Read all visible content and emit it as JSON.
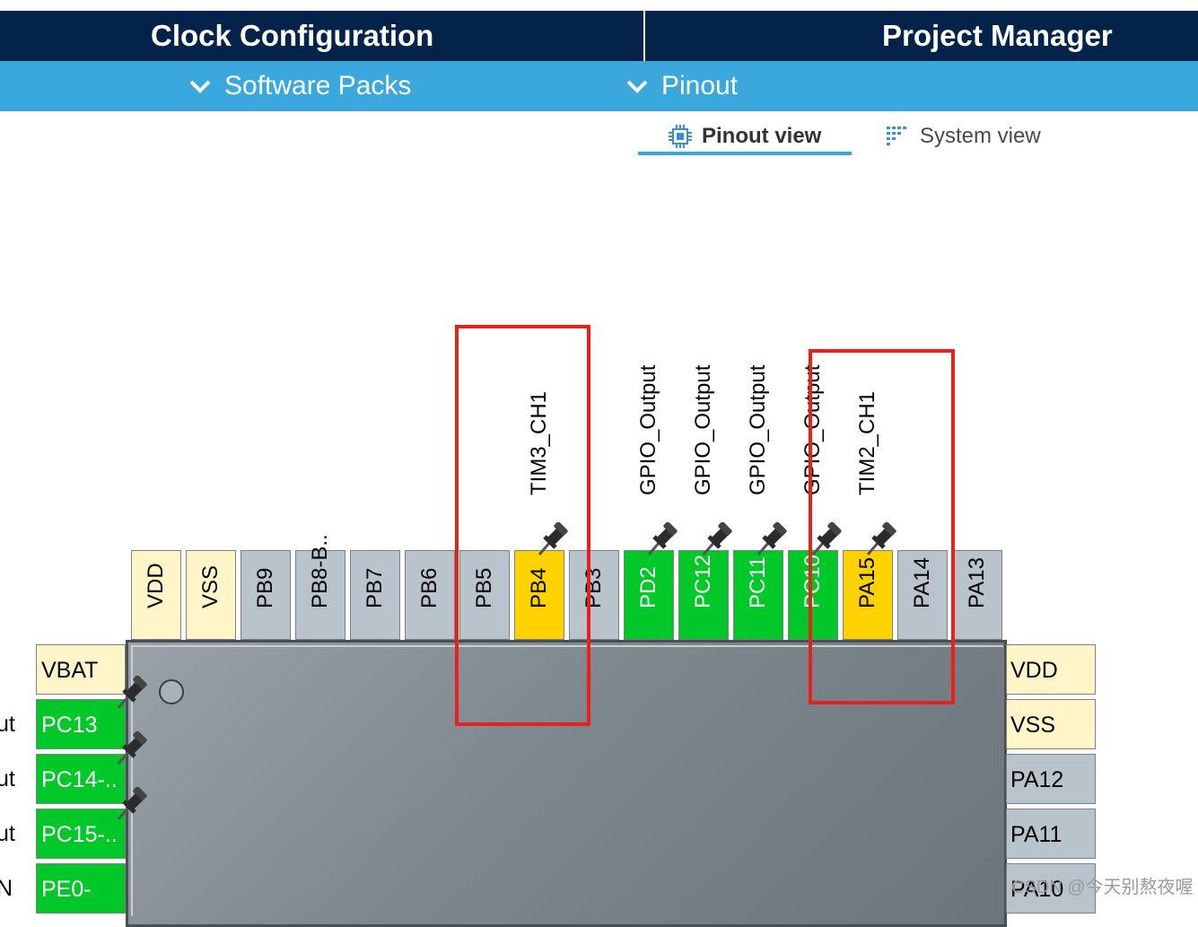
{
  "header": {
    "tabs": [
      {
        "label": "Clock Configuration"
      },
      {
        "label": "Project Manager"
      }
    ]
  },
  "subnav": {
    "items": [
      {
        "label": "Software Packs"
      },
      {
        "label": "Pinout"
      }
    ]
  },
  "views": {
    "pinout_view": "Pinout view",
    "system_view": "System view"
  },
  "colors": {
    "header_dark": "#03234b",
    "subbar_blue": "#3aa8dc",
    "pin_power": "#fff5c8",
    "pin_default": "#b8c3cb",
    "pin_gpio": "#00c828",
    "pin_timer": "#ffd200",
    "highlight_red": "#e8211d"
  },
  "pins_top": [
    {
      "name": "VDD",
      "type": "power"
    },
    {
      "name": "VSS",
      "type": "power"
    },
    {
      "name": "PB9",
      "type": "default"
    },
    {
      "name": "PB8-B..",
      "type": "default"
    },
    {
      "name": "PB7",
      "type": "default"
    },
    {
      "name": "PB6",
      "type": "default"
    },
    {
      "name": "PB5",
      "type": "default"
    },
    {
      "name": "PB4",
      "type": "timer",
      "signal": "TIM3_CH1"
    },
    {
      "name": "PB3",
      "type": "default"
    },
    {
      "name": "PD2",
      "type": "gpio",
      "signal": "GPIO_Output"
    },
    {
      "name": "PC12",
      "type": "gpio",
      "signal": "GPIO_Output"
    },
    {
      "name": "PC11",
      "type": "gpio",
      "signal": "GPIO_Output"
    },
    {
      "name": "PC10",
      "type": "gpio",
      "signal": "GPIO_Output"
    },
    {
      "name": "PA15",
      "type": "timer",
      "signal": "TIM2_CH1"
    },
    {
      "name": "PA14",
      "type": "default"
    },
    {
      "name": "PA13",
      "type": "default"
    }
  ],
  "pins_left": [
    {
      "name": "VBAT",
      "type": "power",
      "outer_label": ""
    },
    {
      "name": "PC13",
      "type": "gpio",
      "outer_label": "ut"
    },
    {
      "name": "PC14-..",
      "type": "gpio",
      "outer_label": "ut"
    },
    {
      "name": "PC15-..",
      "type": "gpio",
      "outer_label": "ut"
    },
    {
      "name": "PE0-",
      "type": "gpio",
      "outer_label": "N"
    }
  ],
  "pins_right": [
    {
      "name": "VDD",
      "type": "power"
    },
    {
      "name": "VSS",
      "type": "power"
    },
    {
      "name": "PA12",
      "type": "default"
    },
    {
      "name": "PA11",
      "type": "default"
    },
    {
      "name": "PA10",
      "type": "default"
    }
  ],
  "watermark": "CSDN @今天别熬夜喔"
}
